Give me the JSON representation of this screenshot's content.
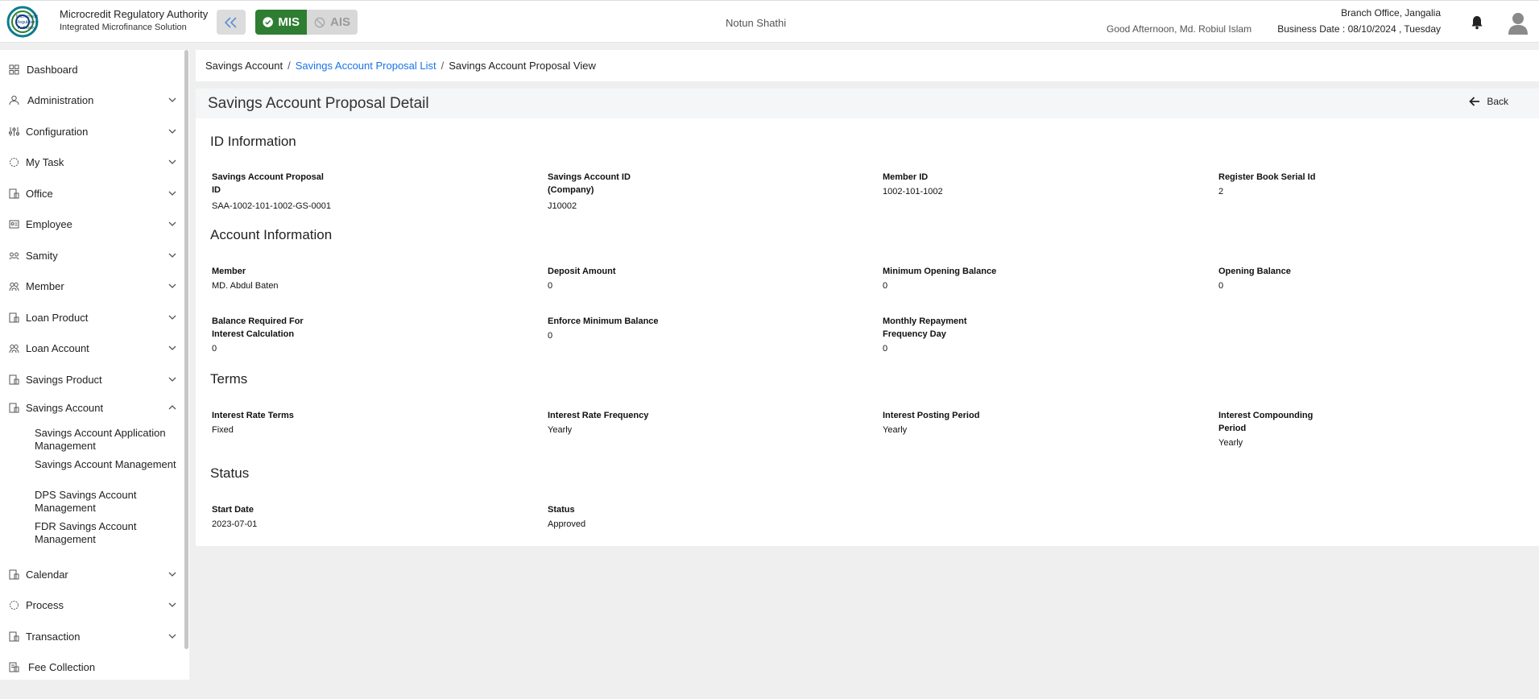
{
  "header": {
    "brand_title": "Microcredit Regulatory Authority",
    "brand_sub": "Integrated Microfinance Solution",
    "logo_text": "Microcredit Regulatory Authority",
    "mode_mis": "MIS",
    "mode_ais": "AIS",
    "org_name": "Notun Shathi",
    "greeting": "Good Afternoon, Md. Robiul Islam",
    "branch": "Branch Office, Jangalia",
    "business_date": "Business Date : 08/10/2024 , Tuesday",
    "colors": {
      "mis": "#2e7d32",
      "link": "#1a73e8"
    }
  },
  "sidebar": {
    "items": [
      {
        "label": "Dashboard",
        "icon": "dashboard-icon"
      },
      {
        "label": "Administration",
        "icon": "admin-icon"
      },
      {
        "label": "Configuration",
        "icon": "sliders-icon"
      },
      {
        "label": "My Task",
        "icon": "circle-icon"
      },
      {
        "label": "Office",
        "icon": "office-icon"
      },
      {
        "label": "Employee",
        "icon": "employee-icon"
      },
      {
        "label": "Samity",
        "icon": "group-icon"
      },
      {
        "label": "Member",
        "icon": "members-icon"
      },
      {
        "label": "Loan Product",
        "icon": "loan-product-icon"
      },
      {
        "label": "Loan Account",
        "icon": "loan-account-icon"
      },
      {
        "label": "Savings Product",
        "icon": "savings-product-icon"
      },
      {
        "label": "Savings Account",
        "icon": "savings-account-icon"
      },
      {
        "label": "Calendar",
        "icon": "calendar-icon"
      },
      {
        "label": "Process",
        "icon": "process-icon"
      },
      {
        "label": "Transaction",
        "icon": "transaction-icon"
      },
      {
        "label": "Fee Collection",
        "icon": "fee-icon"
      }
    ],
    "savings_sub": [
      "Savings Account Application Management",
      "Savings Account Management",
      "DPS Savings Account Management",
      "FDR Savings Account Management"
    ]
  },
  "breadcrumb": {
    "root": "Savings Account",
    "list": "Savings Account Proposal List",
    "current": "Savings Account Proposal View"
  },
  "page": {
    "title": "Savings Account Proposal Detail",
    "back": "Back"
  },
  "sections": {
    "id_info": {
      "title": "ID Information",
      "fields": [
        {
          "label": "Savings Account Proposal ID",
          "value": "SAA-1002-101-1002-GS-0001"
        },
        {
          "label": "Savings Account ID (Company)",
          "value": "J10002"
        },
        {
          "label": "Member ID",
          "value": "1002-101-1002"
        },
        {
          "label": "Register Book Serial Id",
          "value": "2"
        }
      ]
    },
    "account_info": {
      "title": "Account Information",
      "fields": [
        {
          "label": "Member",
          "value": "MD. Abdul Baten"
        },
        {
          "label": "Deposit Amount",
          "value": "0"
        },
        {
          "label": "Minimum Opening Balance",
          "value": "0"
        },
        {
          "label": "Opening Balance",
          "value": "0"
        },
        {
          "label": "Balance Required For Interest Calculation",
          "value": "0"
        },
        {
          "label": "Enforce Minimum Balance",
          "value": "0"
        },
        {
          "label": "Monthly Repayment Frequency Day",
          "value": "0"
        }
      ]
    },
    "terms": {
      "title": "Terms",
      "fields": [
        {
          "label": "Interest Rate Terms",
          "value": "Fixed"
        },
        {
          "label": "Interest Rate Frequency",
          "value": "Yearly"
        },
        {
          "label": "Interest Posting Period",
          "value": "Yearly"
        },
        {
          "label": "Interest Compounding Period",
          "value": "Yearly"
        }
      ]
    },
    "status": {
      "title": "Status",
      "fields": [
        {
          "label": "Start Date",
          "value": "2023-07-01"
        },
        {
          "label": "Status",
          "value": "Approved"
        }
      ]
    }
  }
}
